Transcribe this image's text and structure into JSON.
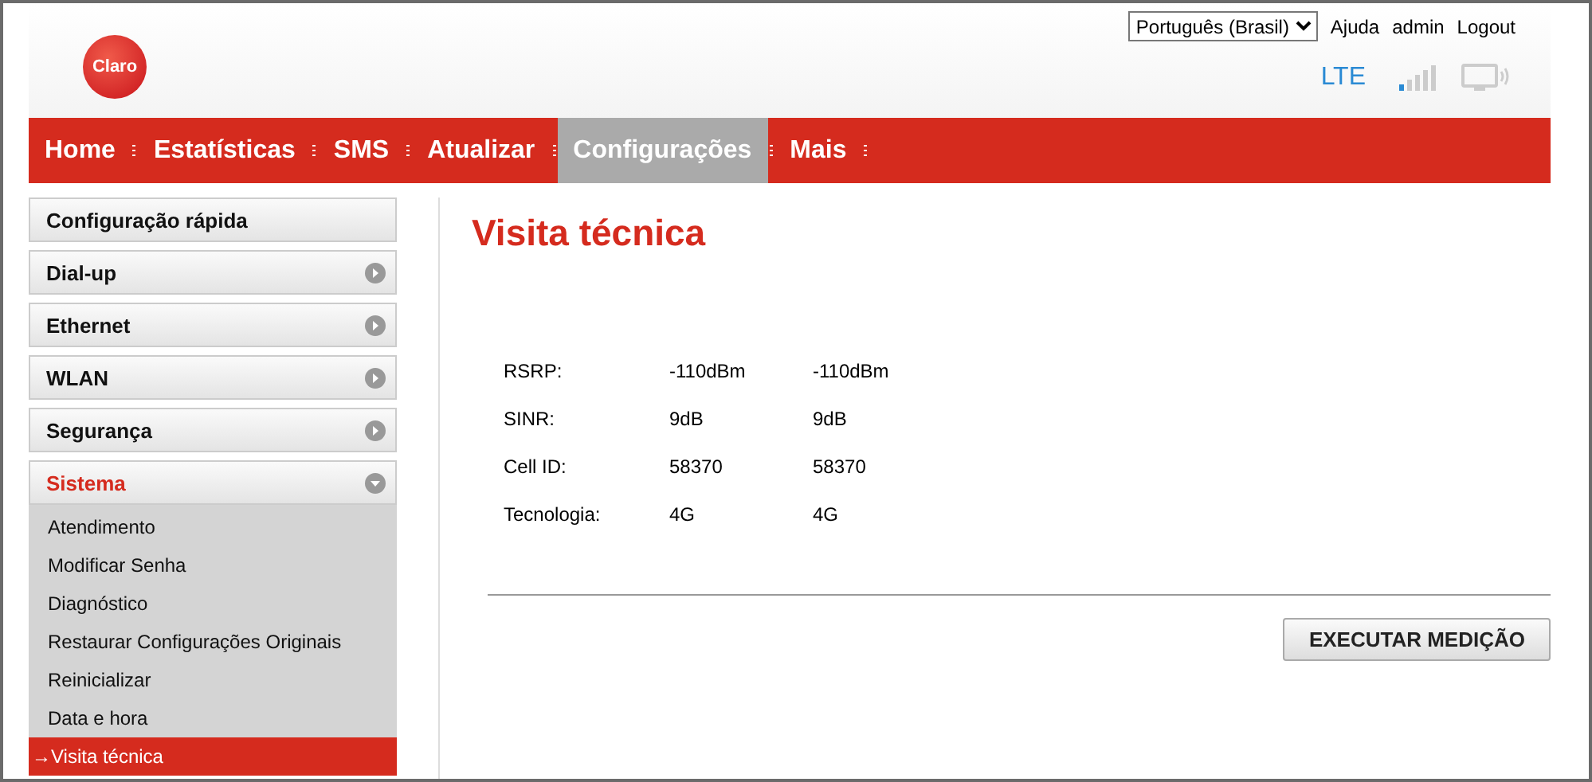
{
  "header": {
    "logo": "Claro",
    "language": "Português (Brasil)",
    "links": [
      "Ajuda",
      "admin",
      "Logout"
    ],
    "network": "LTE"
  },
  "nav": [
    {
      "label": "Home",
      "selected": false
    },
    {
      "label": "Estatísticas",
      "selected": false
    },
    {
      "label": "SMS",
      "selected": false
    },
    {
      "label": "Atualizar",
      "selected": false
    },
    {
      "label": "Configurações",
      "selected": true
    },
    {
      "label": "Mais",
      "selected": false
    }
  ],
  "sidebar": {
    "items": [
      {
        "label": "Configuração rápida",
        "kind": "link",
        "expanded": false
      },
      {
        "label": "Dial-up",
        "kind": "menu",
        "expanded": false
      },
      {
        "label": "Ethernet",
        "kind": "menu",
        "expanded": false
      },
      {
        "label": "WLAN",
        "kind": "menu",
        "expanded": false
      },
      {
        "label": "Segurança",
        "kind": "menu",
        "expanded": false
      },
      {
        "label": "Sistema",
        "kind": "menu",
        "expanded": true,
        "children": [
          {
            "label": "Atendimento",
            "selected": false
          },
          {
            "label": "Modificar Senha",
            "selected": false
          },
          {
            "label": "Diagnóstico",
            "selected": false
          },
          {
            "label": "Restaurar Configurações Originais",
            "selected": false
          },
          {
            "label": "Reinicializar",
            "selected": false
          },
          {
            "label": "Data e hora",
            "selected": false
          },
          {
            "label": "Visita técnica",
            "selected": true,
            "marker": "→"
          }
        ]
      }
    ]
  },
  "page": {
    "title": "Visita técnica",
    "rows": [
      {
        "label": "RSRP:",
        "value_1": "-110dBm",
        "value_2": "-110dBm"
      },
      {
        "label": "SINR:",
        "value_1": "9dB",
        "value_2": "9dB"
      },
      {
        "label": "Cell ID:",
        "value_1": "58370",
        "value_2": "58370"
      },
      {
        "label": "Tecnologia:",
        "value_1": "4G",
        "value_2": "4G"
      }
    ],
    "button": "EXECUTAR MEDIÇÃO"
  }
}
